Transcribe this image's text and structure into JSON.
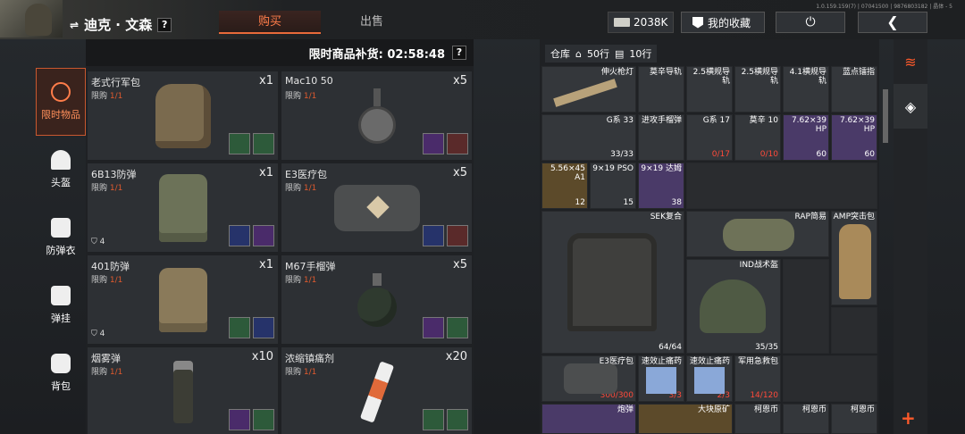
{
  "header": {
    "player_name": "迪克 · 文森",
    "help": "?",
    "tabs": [
      {
        "label": "购买",
        "active": true
      },
      {
        "label": "出售",
        "active": false
      }
    ],
    "version": "1.0.159.159(7) | 07041500 | 9876803182 | 晶体 - 5",
    "money": "2038K",
    "favorites_label": "我的收藏"
  },
  "categories": [
    {
      "label": "限时物品",
      "icon": "clock-icon",
      "active": true
    },
    {
      "label": "头盔",
      "icon": "helmet-icon"
    },
    {
      "label": "防弹衣",
      "icon": "vest-icon"
    },
    {
      "label": "弹挂",
      "icon": "rig-icon"
    },
    {
      "label": "背包",
      "icon": "backpack-icon"
    }
  ],
  "shop": {
    "restock_label": "限时商品补货: 02:58:48",
    "limit_prefix": "限购",
    "limit_value": "1/1",
    "items": [
      {
        "name": "老式行军包",
        "qty": "x1",
        "icon": "backpack-icon"
      },
      {
        "name": "Mac10 50",
        "qty": "x5",
        "icon": "drum-magazine-icon"
      },
      {
        "name": "6B13防弹",
        "qty": "x1",
        "shield": "4",
        "icon": "armor-vest-icon"
      },
      {
        "name": "E3医疗包",
        "qty": "x5",
        "icon": "medkit-icon"
      },
      {
        "name": "401防弹",
        "qty": "x1",
        "shield": "4",
        "icon": "armor-vest-icon"
      },
      {
        "name": "M67手榴弹",
        "qty": "x5",
        "icon": "grenade-icon"
      },
      {
        "name": "烟雾弹",
        "qty": "x10",
        "icon": "smoke-grenade-icon"
      },
      {
        "name": "浓缩镇痛剂",
        "qty": "x20",
        "icon": "syringe-icon"
      }
    ]
  },
  "warehouse": {
    "label": "仓库",
    "rows_home": "50行",
    "rows_extra": "10行",
    "cells": [
      {
        "name": "伸火枪灯",
        "count": ""
      },
      {
        "name": "莫辛导轨",
        "count": ""
      },
      {
        "name": "2.5横规导轨",
        "count": ""
      },
      {
        "name": "2.5横规导轨",
        "count": ""
      },
      {
        "name": "4.1横规导轨",
        "count": ""
      },
      {
        "name": "蓝点镭指",
        "count": ""
      },
      {
        "name": "G系 33",
        "count": "33/33"
      },
      {
        "name": "进攻手榴弹",
        "count": ""
      },
      {
        "name": "G系 17",
        "count": "0/17"
      },
      {
        "name": "莫辛 10",
        "count": "0/10"
      },
      {
        "name": "7.62×39 HP",
        "count": "60"
      },
      {
        "name": "7.62×39 HP",
        "count": "60"
      },
      {
        "name": "5.56×45 A1",
        "count": "12"
      },
      {
        "name": "9×19 PSO",
        "count": "15"
      },
      {
        "name": "9×19 达姆",
        "count": "38"
      },
      {
        "name": "SEK复合",
        "count": "64/64"
      },
      {
        "name": "RAP简易",
        "count": ""
      },
      {
        "name": "AMP突击包",
        "count": ""
      },
      {
        "name": "IND战术盔",
        "count": "35/35"
      },
      {
        "name": "E3医疗包",
        "count": "300/300"
      },
      {
        "name": "速效止痛药",
        "count": "3/3"
      },
      {
        "name": "速效止痛药",
        "count": "2/3"
      },
      {
        "name": "军用急救包",
        "count": "14/120"
      },
      {
        "name": "炮弹",
        "count": ""
      },
      {
        "name": "大块原矿",
        "count": ""
      },
      {
        "name": "柯恩币",
        "count": ""
      },
      {
        "name": "柯恩币",
        "count": ""
      },
      {
        "name": "柯恩币",
        "count": ""
      }
    ]
  },
  "colors": {
    "accent": "#e86a3a",
    "limit": "#e05a2e",
    "red_count": "#ff4a3a"
  }
}
